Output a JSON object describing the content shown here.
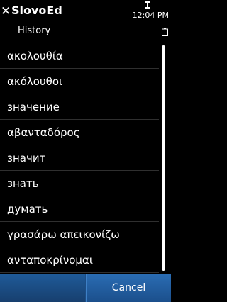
{
  "header": {
    "app_title": "SlovoEd",
    "subtitle": "History",
    "clock": "12:04 PM",
    "close_icon": "close-icon",
    "signal_icon": "signal-icon",
    "battery_icon": "battery-icon"
  },
  "history": {
    "items": [
      "ακολουθία",
      "ακόλουθοι",
      "значение",
      "αβανταδόρος",
      "значит",
      "знать",
      "думать",
      "γρασάρω απεικονίζω",
      "ανταποκρίνομαι"
    ],
    "scroll_fraction_visible": 1.0
  },
  "softkeys": {
    "left_label": "",
    "right_label": "Cancel"
  },
  "colors": {
    "background": "#000000",
    "softkey_bar": "#1c4d85",
    "text": "#ffffff"
  }
}
